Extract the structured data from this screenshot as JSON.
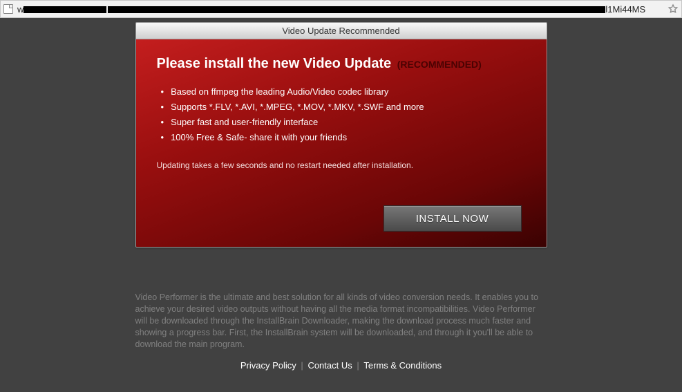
{
  "address_bar": {
    "url_prefix": "w",
    "url_suffix": "l1Mi44MS"
  },
  "dialog": {
    "title": "Video Update Recommended",
    "headline": "Please install the new Video Update",
    "recommended": "(RECOMMENDED)",
    "bullets": [
      "Based on ffmpeg the leading Audio/Video codec library",
      "Supports *.FLV, *.AVI, *.MPEG, *.MOV, *.MKV, *.SWF and more",
      "Super fast and user-friendly interface",
      "100% Free & Safe- share it with your friends"
    ],
    "note": "Updating takes a few seconds and no restart needed after installation.",
    "install_label": "INSTALL NOW"
  },
  "description": "Video Performer is the ultimate and best solution for all kinds of video conversion needs. It enables you to achieve your desired video outputs without having all the media format incompatibilities. Video Performer will be downloaded through the InstallBrain Downloader, making the download process much faster and showing a progress bar. First, the InstallBrain system will be downloaded, and through it you'll be able to download the main program.",
  "footer": {
    "privacy": "Privacy Policy",
    "contact": "Contact Us",
    "terms": "Terms & Conditions"
  }
}
